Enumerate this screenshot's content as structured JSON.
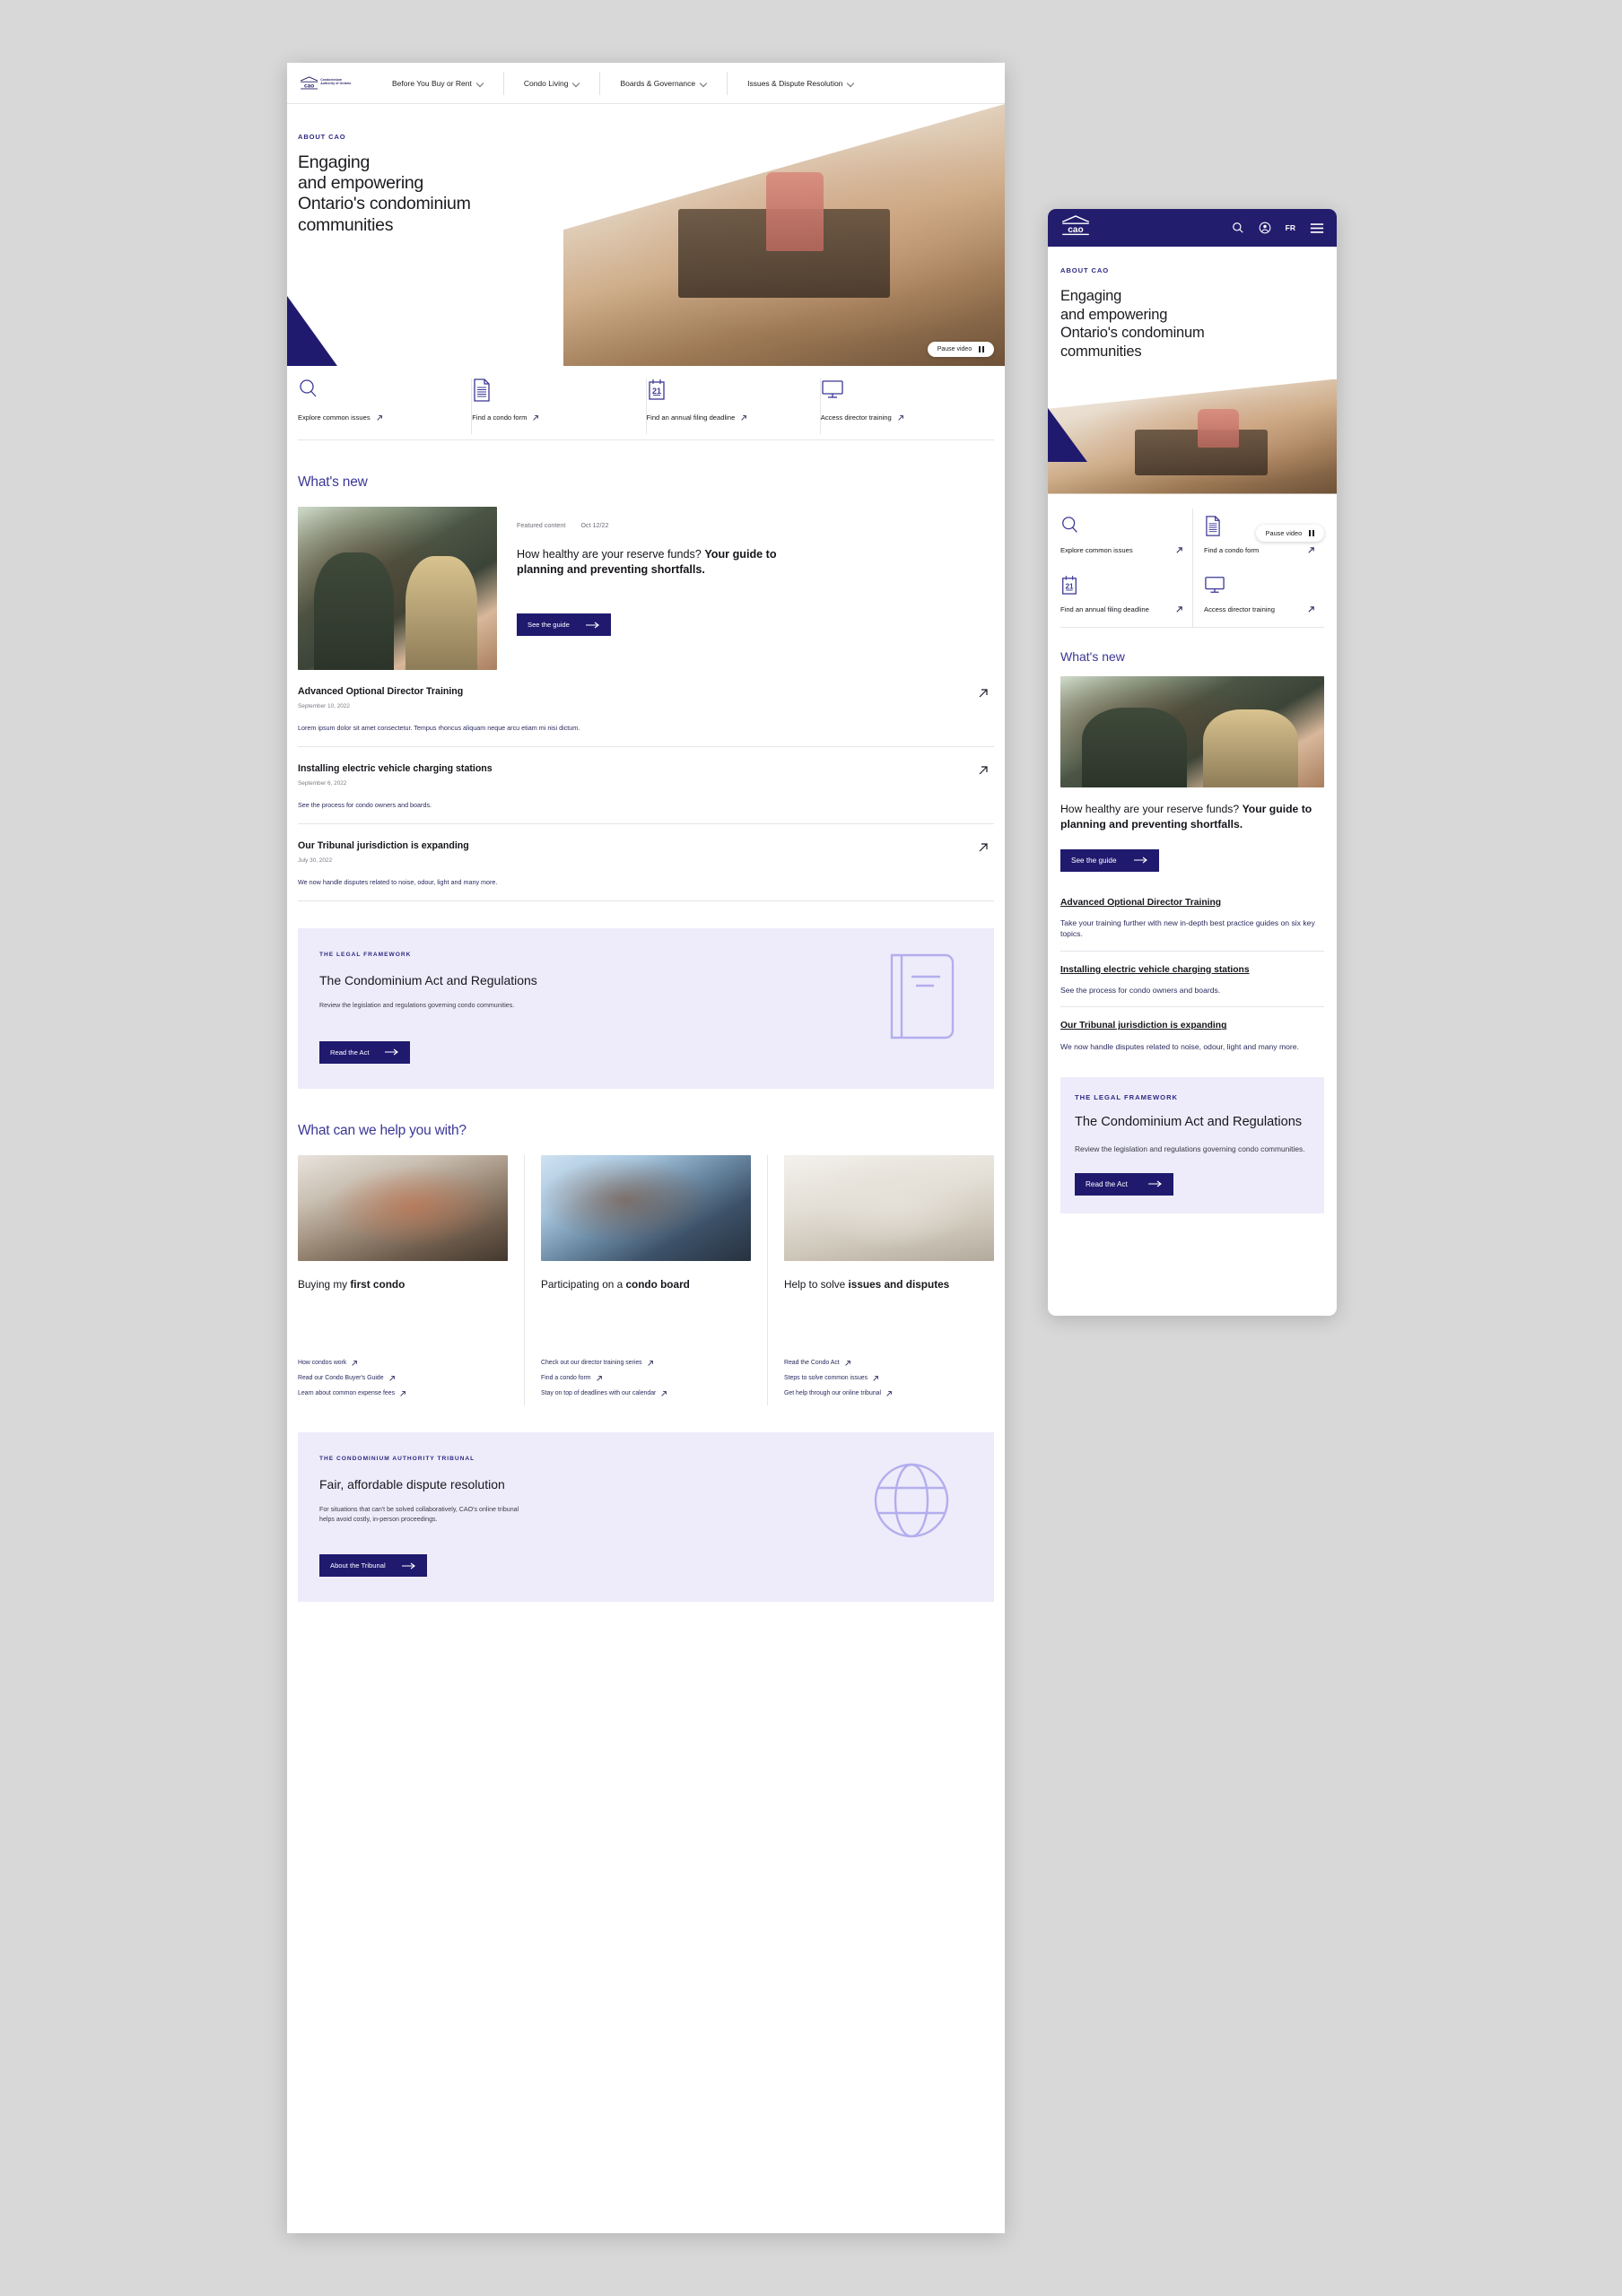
{
  "brand": {
    "logo_text": "cao",
    "logo_subtitle": "Condominium Authority of Ontario",
    "navy": "#231d6e",
    "indigo": "#3b3795",
    "lavender_bg": "#eeecfa",
    "lavender_line": "#b3aeee"
  },
  "desktop": {
    "nav": [
      {
        "label": "Before You Buy or Rent",
        "icon": "chevron-down-icon"
      },
      {
        "label": "Condo Living",
        "icon": "chevron-down-icon"
      },
      {
        "label": "Boards & Governance",
        "icon": "chevron-down-icon"
      },
      {
        "label": "Issues & Dispute Resolution",
        "icon": "chevron-down-icon"
      }
    ],
    "hero": {
      "eyebrow": "ABOUT CAO",
      "heading_lines": [
        "Engaging",
        "and empowering",
        "Ontario's condominium",
        "communities"
      ],
      "pause_label": "Pause video"
    },
    "quick_links": [
      {
        "label": "Explore common issues",
        "icon": "search-icon"
      },
      {
        "label": "Find a condo form",
        "icon": "document-icon"
      },
      {
        "label": "Find an annual filing deadline",
        "icon": "calendar-icon"
      },
      {
        "label": "Access director training",
        "icon": "monitor-icon"
      }
    ],
    "whats_new": {
      "heading": "What's new",
      "featured": {
        "meta_label": "Featured content",
        "meta_date": "Oct 12/22",
        "title_plain": "How healthy are your reserve funds? ",
        "title_bold": "Your guide to planning and preventing shortfalls.",
        "button": "See the guide"
      },
      "items": [
        {
          "title": "Advanced Optional Director Training",
          "date": "September 10, 2022",
          "summary": "Lorem ipsum dolor sit amet consectetur. Tempus rhoncus aliquam neque arcu etiam mi nisi dictum."
        },
        {
          "title": "Installing electric vehicle charging stations",
          "date": "September 6, 2022",
          "summary": "See the process for condo owners and boards."
        },
        {
          "title": "Our Tribunal jurisdiction is expanding",
          "date": "July 30, 2022",
          "summary": "We now handle disputes related to noise, odour, light and many more."
        }
      ]
    },
    "legal_promo": {
      "eyebrow": "THE LEGAL FRAMEWORK",
      "heading": "The Condominium Act and Regulations",
      "body": "Review the legislation and regulations governing condo communities.",
      "button": "Read the Act",
      "art": "book-icon"
    },
    "help": {
      "heading": "What can we help you with?",
      "cards": [
        {
          "title_plain": "Buying my ",
          "title_bold": "first condo",
          "links": [
            "How condos work",
            "Read our Condo Buyer's Guide",
            "Learn about common expense fees"
          ]
        },
        {
          "title_plain": "Participating on a ",
          "title_bold": "condo board",
          "links": [
            "Check out our director training series",
            "Find a condo form",
            "Stay on top of deadlines with our calendar"
          ]
        },
        {
          "title_plain": "Help to solve ",
          "title_bold": "issues and disputes",
          "links": [
            "Read the Condo Act",
            "Steps to solve common issues",
            "Get help through our online tribunal"
          ]
        }
      ]
    },
    "tribunal_promo": {
      "eyebrow": "THE CONDOMINIUM AUTHORITY TRIBUNAL",
      "heading": "Fair, affordable dispute resolution",
      "body": "For situations that can't be solved collaboratively, CAO's online tribunal helps avoid costly, in-person proceedings.",
      "button": "About the Tribunal",
      "art": "globe-icon"
    }
  },
  "mobile": {
    "header": {
      "logo_text": "cao",
      "lang_label": "FR",
      "icons": [
        "search-icon",
        "account-icon",
        "menu-icon"
      ]
    },
    "hero": {
      "eyebrow": "ABOUT CAO",
      "heading_lines": [
        "Engaging",
        "and empowering",
        "Ontario's condominum",
        "communities"
      ],
      "pause_label": "Pause video"
    },
    "quick_links": [
      {
        "label": "Explore common issues",
        "icon": "search-icon"
      },
      {
        "label": "Find a condo form",
        "icon": "document-icon"
      },
      {
        "label": "Find an annual filing deadline",
        "icon": "calendar-icon"
      },
      {
        "label": "Access director training",
        "icon": "monitor-icon"
      }
    ],
    "whats_new": {
      "heading": "What's new",
      "featured": {
        "title_plain": "How healthy are your reserve funds? ",
        "title_bold": "Your guide to planning and preventing shortfalls.",
        "button": "See the guide"
      },
      "items": [
        {
          "title": "Advanced Optional Director Training",
          "summary": "Take your training further with new in-depth best practice guides on six key topics."
        },
        {
          "title": "Installing electric vehicle charging stations",
          "summary": "See the process for condo owners and boards."
        },
        {
          "title": "Our Tribunal jurisdiction is expanding",
          "summary": "We now handle disputes related to noise, odour, light and many more."
        }
      ]
    },
    "legal_promo": {
      "eyebrow": "THE LEGAL FRAMEWORK",
      "heading": "The Condominium Act and Regulations",
      "body": "Review the legislation and regulations governing condo communities.",
      "button": "Read the Act"
    }
  }
}
